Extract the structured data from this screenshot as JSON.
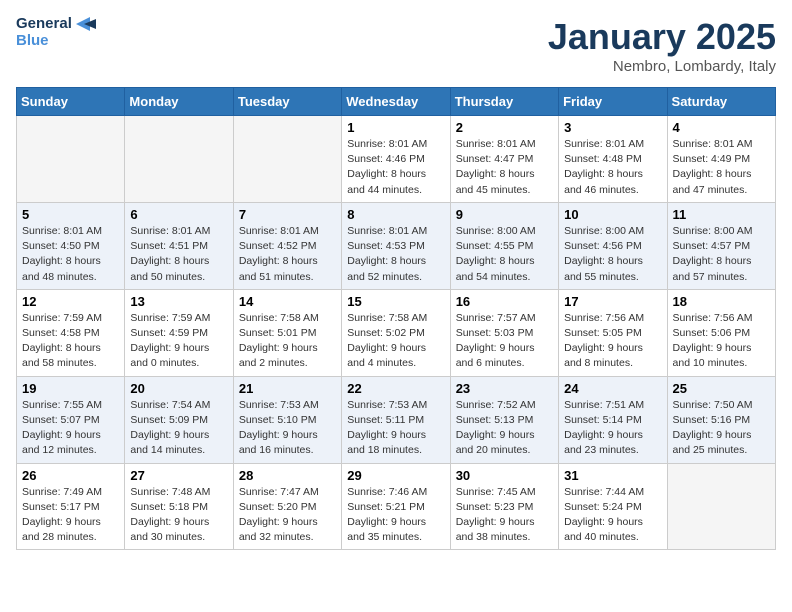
{
  "logo": {
    "line1": "General",
    "line2": "Blue"
  },
  "title": "January 2025",
  "subtitle": "Nembro, Lombardy, Italy",
  "weekdays": [
    "Sunday",
    "Monday",
    "Tuesday",
    "Wednesday",
    "Thursday",
    "Friday",
    "Saturday"
  ],
  "weeks": [
    [
      {
        "day": "",
        "info": ""
      },
      {
        "day": "",
        "info": ""
      },
      {
        "day": "",
        "info": ""
      },
      {
        "day": "1",
        "info": "Sunrise: 8:01 AM\nSunset: 4:46 PM\nDaylight: 8 hours\nand 44 minutes."
      },
      {
        "day": "2",
        "info": "Sunrise: 8:01 AM\nSunset: 4:47 PM\nDaylight: 8 hours\nand 45 minutes."
      },
      {
        "day": "3",
        "info": "Sunrise: 8:01 AM\nSunset: 4:48 PM\nDaylight: 8 hours\nand 46 minutes."
      },
      {
        "day": "4",
        "info": "Sunrise: 8:01 AM\nSunset: 4:49 PM\nDaylight: 8 hours\nand 47 minutes."
      }
    ],
    [
      {
        "day": "5",
        "info": "Sunrise: 8:01 AM\nSunset: 4:50 PM\nDaylight: 8 hours\nand 48 minutes."
      },
      {
        "day": "6",
        "info": "Sunrise: 8:01 AM\nSunset: 4:51 PM\nDaylight: 8 hours\nand 50 minutes."
      },
      {
        "day": "7",
        "info": "Sunrise: 8:01 AM\nSunset: 4:52 PM\nDaylight: 8 hours\nand 51 minutes."
      },
      {
        "day": "8",
        "info": "Sunrise: 8:01 AM\nSunset: 4:53 PM\nDaylight: 8 hours\nand 52 minutes."
      },
      {
        "day": "9",
        "info": "Sunrise: 8:00 AM\nSunset: 4:55 PM\nDaylight: 8 hours\nand 54 minutes."
      },
      {
        "day": "10",
        "info": "Sunrise: 8:00 AM\nSunset: 4:56 PM\nDaylight: 8 hours\nand 55 minutes."
      },
      {
        "day": "11",
        "info": "Sunrise: 8:00 AM\nSunset: 4:57 PM\nDaylight: 8 hours\nand 57 minutes."
      }
    ],
    [
      {
        "day": "12",
        "info": "Sunrise: 7:59 AM\nSunset: 4:58 PM\nDaylight: 8 hours\nand 58 minutes."
      },
      {
        "day": "13",
        "info": "Sunrise: 7:59 AM\nSunset: 4:59 PM\nDaylight: 9 hours\nand 0 minutes."
      },
      {
        "day": "14",
        "info": "Sunrise: 7:58 AM\nSunset: 5:01 PM\nDaylight: 9 hours\nand 2 minutes."
      },
      {
        "day": "15",
        "info": "Sunrise: 7:58 AM\nSunset: 5:02 PM\nDaylight: 9 hours\nand 4 minutes."
      },
      {
        "day": "16",
        "info": "Sunrise: 7:57 AM\nSunset: 5:03 PM\nDaylight: 9 hours\nand 6 minutes."
      },
      {
        "day": "17",
        "info": "Sunrise: 7:56 AM\nSunset: 5:05 PM\nDaylight: 9 hours\nand 8 minutes."
      },
      {
        "day": "18",
        "info": "Sunrise: 7:56 AM\nSunset: 5:06 PM\nDaylight: 9 hours\nand 10 minutes."
      }
    ],
    [
      {
        "day": "19",
        "info": "Sunrise: 7:55 AM\nSunset: 5:07 PM\nDaylight: 9 hours\nand 12 minutes."
      },
      {
        "day": "20",
        "info": "Sunrise: 7:54 AM\nSunset: 5:09 PM\nDaylight: 9 hours\nand 14 minutes."
      },
      {
        "day": "21",
        "info": "Sunrise: 7:53 AM\nSunset: 5:10 PM\nDaylight: 9 hours\nand 16 minutes."
      },
      {
        "day": "22",
        "info": "Sunrise: 7:53 AM\nSunset: 5:11 PM\nDaylight: 9 hours\nand 18 minutes."
      },
      {
        "day": "23",
        "info": "Sunrise: 7:52 AM\nSunset: 5:13 PM\nDaylight: 9 hours\nand 20 minutes."
      },
      {
        "day": "24",
        "info": "Sunrise: 7:51 AM\nSunset: 5:14 PM\nDaylight: 9 hours\nand 23 minutes."
      },
      {
        "day": "25",
        "info": "Sunrise: 7:50 AM\nSunset: 5:16 PM\nDaylight: 9 hours\nand 25 minutes."
      }
    ],
    [
      {
        "day": "26",
        "info": "Sunrise: 7:49 AM\nSunset: 5:17 PM\nDaylight: 9 hours\nand 28 minutes."
      },
      {
        "day": "27",
        "info": "Sunrise: 7:48 AM\nSunset: 5:18 PM\nDaylight: 9 hours\nand 30 minutes."
      },
      {
        "day": "28",
        "info": "Sunrise: 7:47 AM\nSunset: 5:20 PM\nDaylight: 9 hours\nand 32 minutes."
      },
      {
        "day": "29",
        "info": "Sunrise: 7:46 AM\nSunset: 5:21 PM\nDaylight: 9 hours\nand 35 minutes."
      },
      {
        "day": "30",
        "info": "Sunrise: 7:45 AM\nSunset: 5:23 PM\nDaylight: 9 hours\nand 38 minutes."
      },
      {
        "day": "31",
        "info": "Sunrise: 7:44 AM\nSunset: 5:24 PM\nDaylight: 9 hours\nand 40 minutes."
      },
      {
        "day": "",
        "info": ""
      }
    ]
  ]
}
